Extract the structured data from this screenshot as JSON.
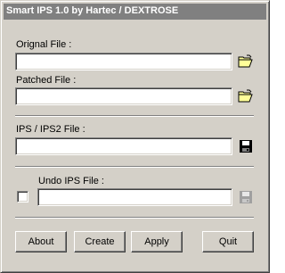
{
  "window": {
    "title": "Smart IPS 1.0 by Hartec / DEXTROSE"
  },
  "original": {
    "label": "Orignal File :",
    "value": "",
    "browse_icon": "open-folder-icon"
  },
  "patched": {
    "label": "Patched File :",
    "value": "",
    "browse_icon": "open-folder-icon"
  },
  "ips": {
    "label": "IPS / IPS2 File :",
    "value": "",
    "save_icon": "floppy-disk-icon"
  },
  "undo": {
    "label": "Undo IPS File :",
    "value": "",
    "checked": false,
    "save_icon": "floppy-disk-icon"
  },
  "buttons": {
    "about": "About",
    "create": "Create",
    "apply": "Apply",
    "quit": "Quit"
  },
  "colors": {
    "face": "#d4d0c8",
    "title_bar_inactive": "#808080",
    "folder_yellow": "#ffff99"
  }
}
